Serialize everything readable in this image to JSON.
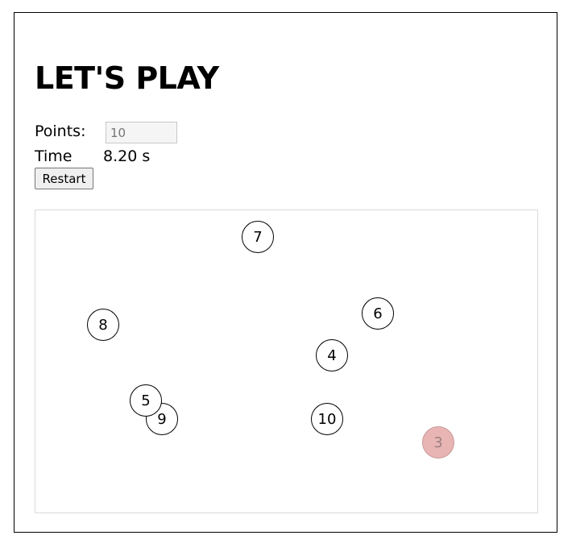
{
  "game": {
    "title": "LET'S PLAY",
    "points_label": "Points:",
    "points_value": "10",
    "time_label": "Time",
    "time_value": "8.20 s",
    "restart_label": "Restart"
  },
  "board": {
    "points": [
      {
        "label": "7",
        "state": "active"
      },
      {
        "label": "8",
        "state": "active"
      },
      {
        "label": "6",
        "state": "active"
      },
      {
        "label": "4",
        "state": "active"
      },
      {
        "label": "5",
        "state": "active"
      },
      {
        "label": "9",
        "state": "active"
      },
      {
        "label": "10",
        "state": "active"
      },
      {
        "label": "3",
        "state": "cleared"
      }
    ],
    "cleared_color": "#e8b4b4"
  }
}
